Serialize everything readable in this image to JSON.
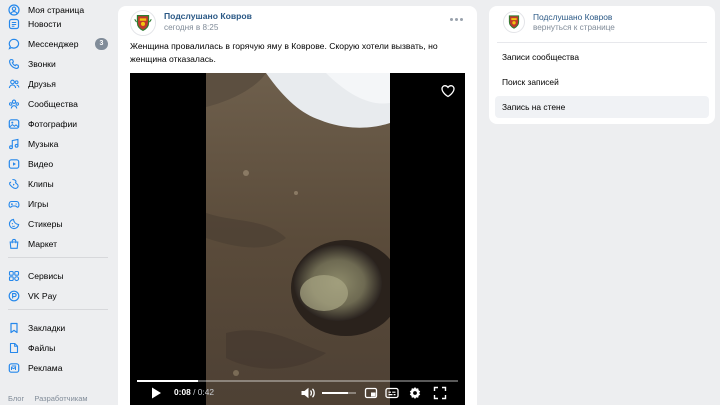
{
  "sidebar": {
    "items": [
      {
        "label": "Моя страница",
        "icon": "user-circle-icon"
      },
      {
        "label": "Новости",
        "icon": "news-icon"
      },
      {
        "label": "Мессенджер",
        "icon": "message-icon",
        "count": "3"
      },
      {
        "label": "Звонки",
        "icon": "phone-icon"
      },
      {
        "label": "Друзья",
        "icon": "friends-icon"
      },
      {
        "label": "Сообщества",
        "icon": "communities-icon"
      },
      {
        "label": "Фотографии",
        "icon": "photo-icon"
      },
      {
        "label": "Музыка",
        "icon": "music-icon"
      },
      {
        "label": "Видео",
        "icon": "video-icon"
      },
      {
        "label": "Клипы",
        "icon": "clips-icon"
      },
      {
        "label": "Игры",
        "icon": "games-icon"
      },
      {
        "label": "Стикеры",
        "icon": "stickers-icon"
      },
      {
        "label": "Маркет",
        "icon": "market-icon"
      },
      {
        "label": "Сервисы",
        "icon": "services-icon"
      },
      {
        "label": "VK Pay",
        "icon": "vkpay-icon"
      },
      {
        "label": "Закладки",
        "icon": "bookmark-icon"
      },
      {
        "label": "Файлы",
        "icon": "files-icon"
      },
      {
        "label": "Реклама",
        "icon": "ads-icon"
      }
    ],
    "footer": [
      "Блог",
      "Разработчикам"
    ]
  },
  "post": {
    "author": "Подслушано Ковров",
    "time": "сегодня в 8:25",
    "text": "Женщина провалилась в горячую яму в Коврове. Скорую хотели вызвать, но женщина отказалась.",
    "video": {
      "current_time": "0:08",
      "separator": "/",
      "duration": "0:42",
      "progress": 0.19,
      "volume": 0.75
    }
  },
  "right_panel": {
    "title": "Подслушано Ковров",
    "back": "вернуться к странице",
    "items": [
      {
        "label": "Записи сообщества",
        "active": false
      },
      {
        "label": "Поиск записей",
        "active": false
      },
      {
        "label": "Запись на стене",
        "active": true
      }
    ]
  },
  "colors": {
    "accent": "#2a5885",
    "nav_icon": "#2688eb",
    "background": "#edeef0",
    "badge": "#818c99"
  }
}
